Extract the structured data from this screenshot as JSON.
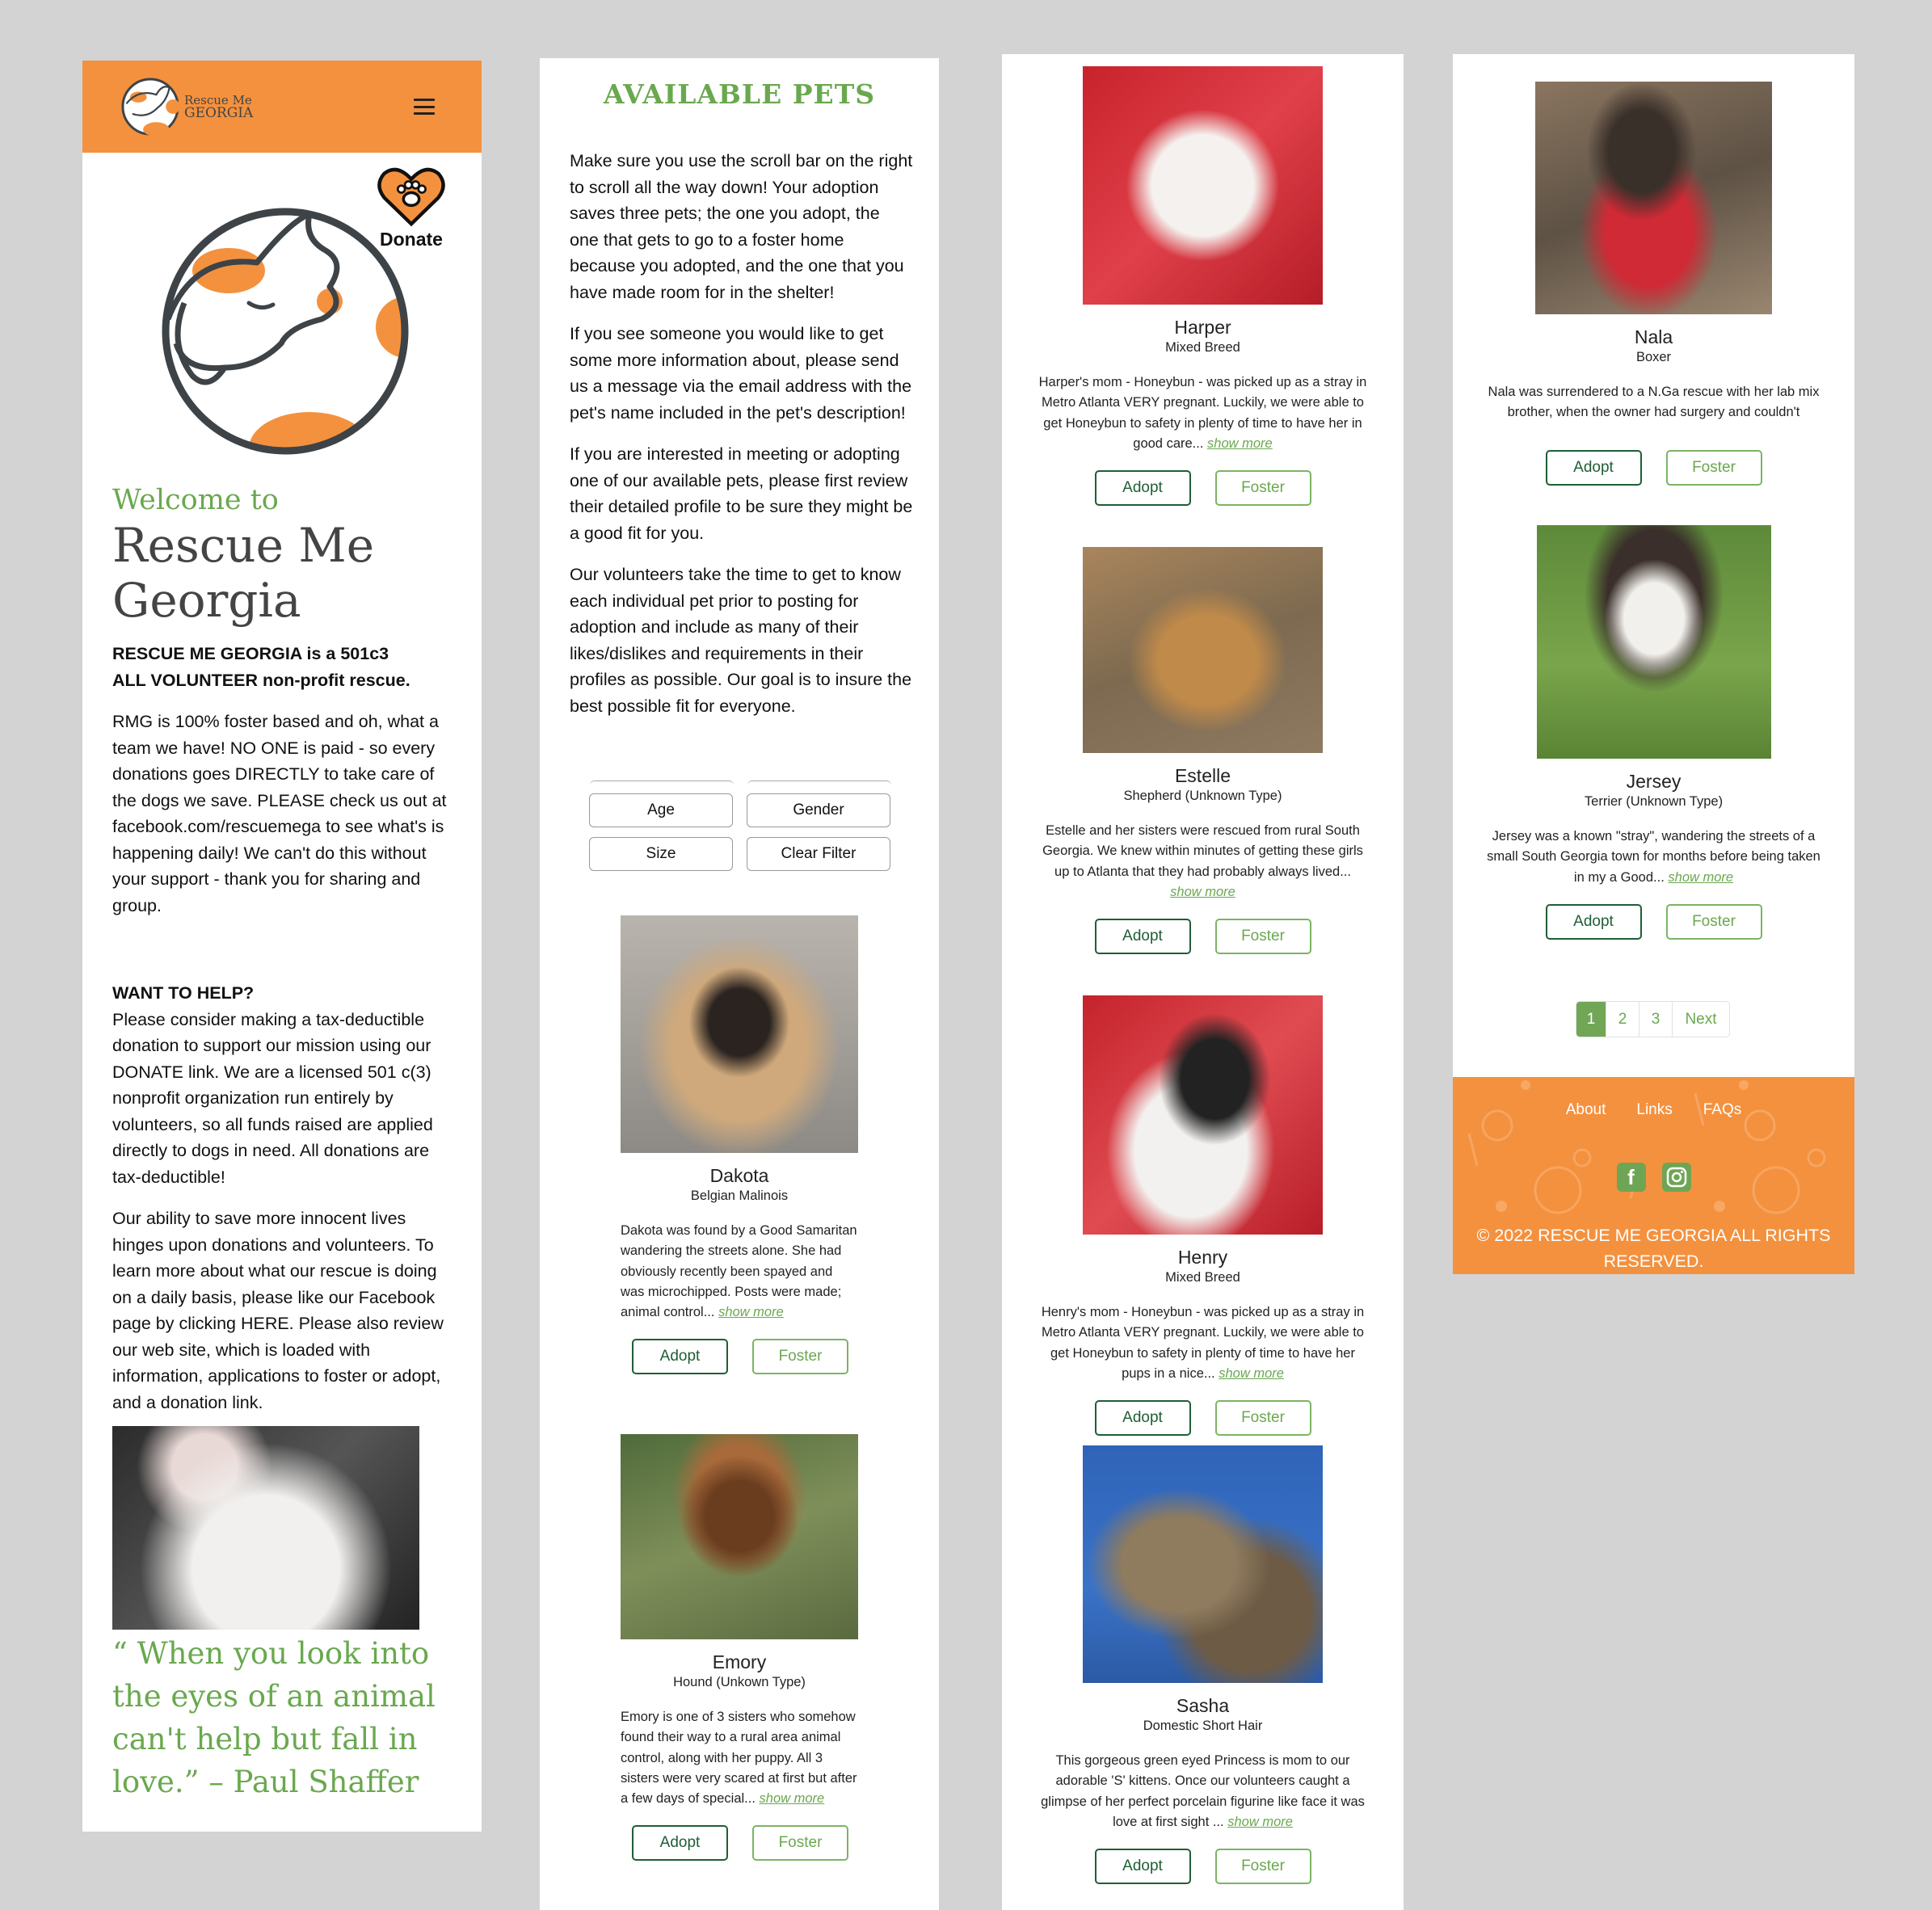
{
  "colors": {
    "brand_orange": "#f4913e",
    "brand_green": "#6aa84f",
    "adopt_green": "#1f5e35",
    "background": "#d3d3d3"
  },
  "home": {
    "logo": {
      "line1": "Rescue Me",
      "line2": "GEORGIA"
    },
    "menu_icon": "hamburger-icon",
    "donate_label": "Donate",
    "welcome": "Welcome to",
    "title_line1": "Rescue Me",
    "title_line2": "Georgia",
    "intro_bold_line1": "RESCUE ME GEORGIA is a 501c3",
    "intro_bold_line2": "ALL VOLUNTEER non-profit rescue.",
    "intro_para": "RMG is 100% foster based and oh, what a team we have! NO ONE is paid - so every donations goes DIRECTLY to take care of the dogs we save. PLEASE check us out at facebook.com/rescuemega to see what's is happening daily! We can't do this without your support - thank you for sharing and group.",
    "help_heading": "WANT TO HELP?",
    "help_para1": "Please consider making a tax-deductible donation to support our mission using our DONATE link. We are a licensed 501 c(3) nonprofit organization run entirely by volunteers, so all funds raised are applied directly to dogs in need. All donations are tax-deductible!",
    "help_para2": "Our ability to save more innocent lives hinges upon donations and volunteers. To learn more about what our rescue is doing on a daily basis, please like our Facebook page by clicking HERE. Please also review our web site, which is loaded with information, applications to foster or adopt, and a donation link.",
    "quote": "“ When you look into the eyes of an animal can't help but fall in love.” – Paul Shaffer"
  },
  "available": {
    "title": "AVAILABLE PETS",
    "paragraphs": [
      "Make sure you use the scroll bar on the right to scroll all the way down! Your adoption saves three pets; the one you adopt, the one that gets to go to a foster home because you adopted, and the one that you have made room for in the shelter!",
      "If you see someone you would like to get some more information about, please send us a message via the email address with the pet's name included in the pet's description!",
      "If you are interested in meeting or adopting one of our available pets, please first review their detailed profile to be sure they might be a good fit for you.",
      "Our volunteers take the time to get to know each individual pet prior to posting for adoption and include as many of their likes/dislikes and requirements in their profiles as possible. Our goal is to insure the best possible fit for everyone."
    ],
    "filters": {
      "age": "Age",
      "gender": "Gender",
      "size": "Size",
      "clear": "Clear Filter"
    }
  },
  "buttons": {
    "adopt": "Adopt",
    "foster": "Foster",
    "show_more": "show more"
  },
  "pets": [
    {
      "name": "Dakota",
      "breed": "Belgian Malinois",
      "desc": "Dakota was found by a Good Samaritan wandering the streets alone. She had obviously recently been spayed and was microchipped. Posts were made; animal control..."
    },
    {
      "name": "Emory",
      "breed": "Hound (Unkown Type)",
      "desc": "Emory is one of 3 sisters who somehow found their way to a rural area animal control, along with her puppy. All 3 sisters were very scared at first but after a few days of special..."
    },
    {
      "name": "Harper",
      "breed": "Mixed Breed",
      "desc": "Harper's mom - Honeybun - was picked up as a stray in Metro Atlanta VERY pregnant. Luckily, we were able to get Honeybun to safety in plenty of time to have her in good care..."
    },
    {
      "name": "Estelle",
      "breed": "Shepherd (Unknown Type)",
      "desc": "Estelle and her sisters were rescued from rural South Georgia. We knew within minutes of getting these girls up to Atlanta that they had probably always lived..."
    },
    {
      "name": "Henry",
      "breed": "Mixed Breed",
      "desc": "Henry's mom - Honeybun - was picked up as a stray in Metro Atlanta VERY pregnant. Luckily, we were able to get Honeybun to safety in plenty of time to have her pups in a nice..."
    },
    {
      "name": "Sasha",
      "breed": "Domestic Short Hair",
      "desc": "This gorgeous green eyed Princess is mom to our adorable 'S' kittens. Once our volunteers caught a glimpse of her perfect porcelain figurine like face it was love at first sight ..."
    },
    {
      "name": "Nala",
      "breed": "Boxer",
      "desc": "Nala was surrendered to a N.Ga rescue with her lab mix brother, when the owner had surgery and couldn't"
    },
    {
      "name": "Jersey",
      "breed": "Terrier (Unknown Type)",
      "desc": "Jersey was a known \"stray\", wandering the streets of a small South Georgia town for months before being taken in my a Good..."
    }
  ],
  "pagination": {
    "pages": [
      "1",
      "2",
      "3"
    ],
    "current": "1",
    "next": "Next"
  },
  "footer": {
    "links": [
      "About",
      "Links",
      "FAQs"
    ],
    "social": [
      "facebook-icon",
      "instagram-icon"
    ],
    "copyright": "© 2022 RESCUE ME GEORGIA ALL RIGHTS RESERVED."
  }
}
